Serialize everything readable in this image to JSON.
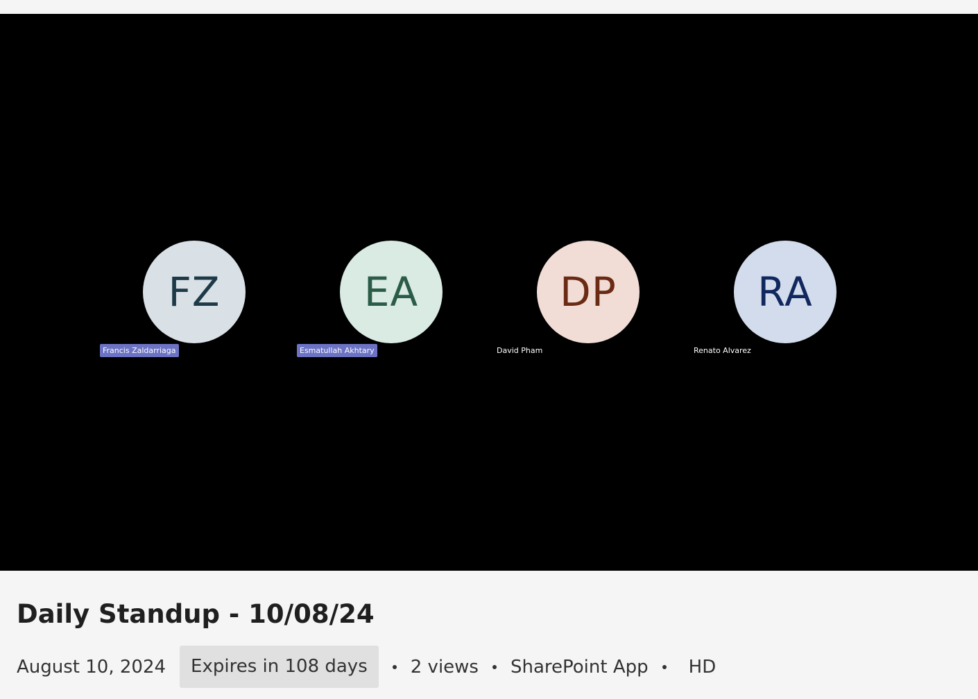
{
  "meeting": {
    "participants": [
      {
        "initials": "FZ",
        "name": "Francis Zaldarriaga",
        "avatar_bg": "#d9e0e6",
        "avatar_fg": "#1e3a48",
        "name_highlighted": true
      },
      {
        "initials": "EA",
        "name": "Esmatullah Akhtary",
        "avatar_bg": "#d9ebe3",
        "avatar_fg": "#2a5c47",
        "name_highlighted": true
      },
      {
        "initials": "DP",
        "name": "David Pham",
        "avatar_bg": "#f1ddd6",
        "avatar_fg": "#6a2a14",
        "name_highlighted": false
      },
      {
        "initials": "RA",
        "name": "Renato Alvarez",
        "avatar_bg": "#d3dcec",
        "avatar_fg": "#10285e",
        "name_highlighted": false
      }
    ]
  },
  "video_info": {
    "title": "Daily Standup - 10/08/24",
    "date": "August 10, 2024",
    "expires": "Expires in 108 days",
    "views": "2 views",
    "source": "SharePoint App",
    "quality": "HD"
  },
  "colors": {
    "video_bg": "#000000",
    "page_bg": "#f5f5f5",
    "name_tag_highlight": "#6c73c4"
  }
}
